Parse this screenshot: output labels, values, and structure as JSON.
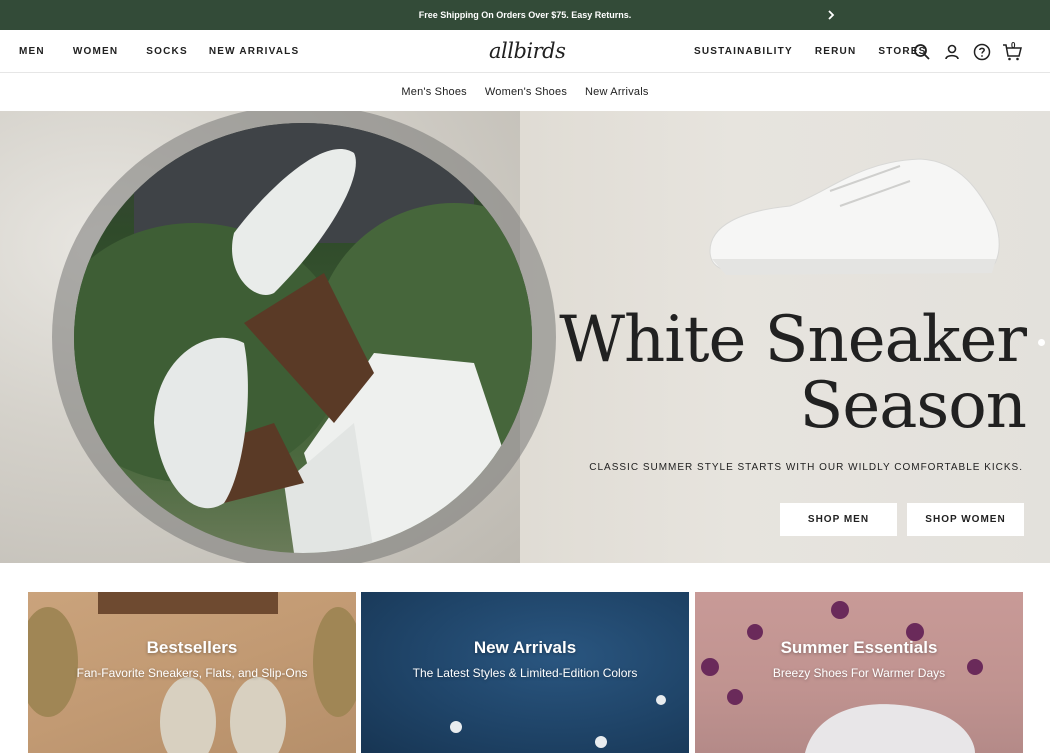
{
  "promo": {
    "text": "Free Shipping On Orders Over $75. Easy Returns."
  },
  "header": {
    "logo": "allbirds",
    "nav_left": [
      "MEN",
      "WOMEN",
      "SOCKS",
      "NEW ARRIVALS"
    ],
    "nav_right": [
      "SUSTAINABILITY",
      "RERUN",
      "STORES"
    ],
    "cart_count": "0"
  },
  "subnav": [
    "Men's Shoes",
    "Women's Shoes",
    "New Arrivals"
  ],
  "hero": {
    "headline_line1": "White Sneaker",
    "headline_line2": "Season",
    "tagline": "CLASSIC SUMMER STYLE STARTS WITH OUR WILDLY COMFORTABLE KICKS.",
    "shop_men": "SHOP MEN",
    "shop_women": "SHOP WOMEN"
  },
  "tiles": [
    {
      "title": "Bestsellers",
      "subtitle": "Fan-Favorite Sneakers, Flats, and Slip-Ons"
    },
    {
      "title": "New Arrivals",
      "subtitle": "The Latest Styles & Limited-Edition Colors"
    },
    {
      "title": "Summer Essentials",
      "subtitle": "Breezy Shoes For Warmer Days"
    }
  ],
  "colors": {
    "promo_bar": "#334b38",
    "text": "#212121",
    "button_bg": "#ffffff"
  },
  "icons": [
    "chevron-right-icon",
    "search-icon",
    "account-icon",
    "help-icon",
    "cart-icon"
  ]
}
